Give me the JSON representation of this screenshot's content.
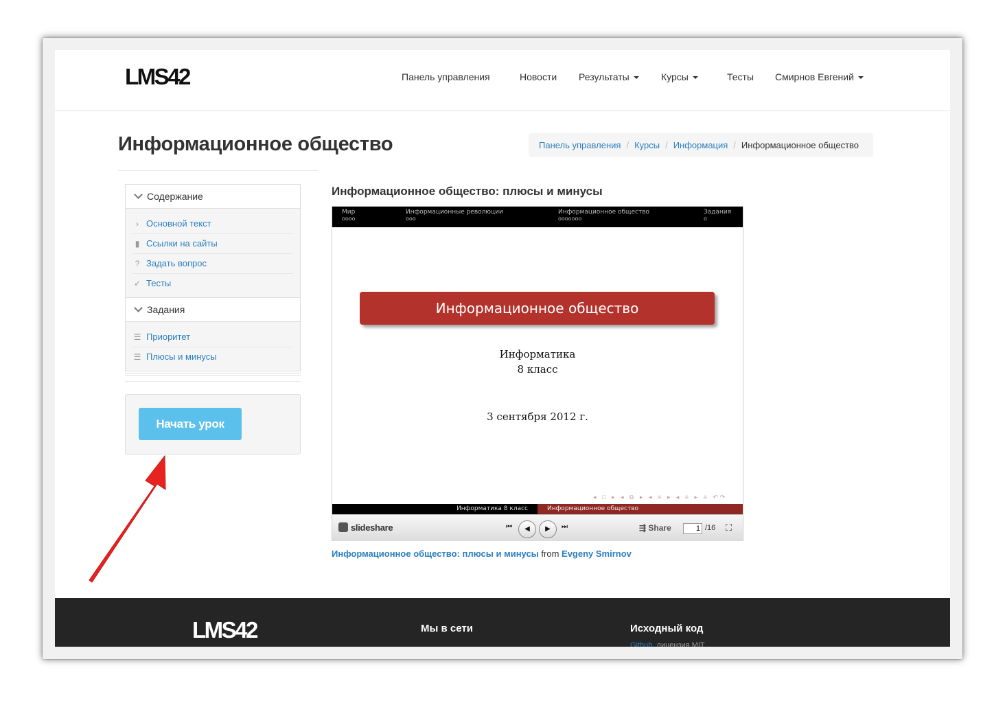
{
  "navbar": {
    "logo": "LMS42",
    "links": [
      "Панель управления",
      "Новости",
      "Результаты",
      "Курсы",
      "Тесты",
      "Смирнов Евгений"
    ]
  },
  "page": {
    "title": "Информационное общество",
    "breadcrumb": [
      "Панель управления",
      "Курсы",
      "Информация",
      "Информационное общество"
    ]
  },
  "sidebar": {
    "contents_header": "Содержание",
    "contents_items": [
      {
        "icon": "chevron-right-icon",
        "label": "Основной текст"
      },
      {
        "icon": "bookmark-icon",
        "label": "Ссылки на сайты"
      },
      {
        "icon": "question-icon",
        "label": "Задать вопрос"
      },
      {
        "icon": "check-icon",
        "label": "Тесты"
      }
    ],
    "tasks_header": "Задания",
    "tasks_items": [
      {
        "icon": "list-icon",
        "label": "Приоритет"
      },
      {
        "icon": "list-icon",
        "label": "Плюсы и минусы"
      }
    ],
    "start_button": "Начать урок"
  },
  "main": {
    "heading": "Информационное общество: плюсы и минусы",
    "slide": {
      "sections": [
        {
          "name": "Мир",
          "dots": "oooo"
        },
        {
          "name": "Информационные революции",
          "dots": "ooo"
        },
        {
          "name": "Информационное общество",
          "dots": "ooooooo"
        },
        {
          "name": "Задания",
          "dots": "o"
        }
      ],
      "title": "Информационное общество",
      "subject": "Информатика",
      "grade": "8 класс",
      "date": "3 сентября 2012 г.",
      "footer_left": "Информатика   8 класс",
      "footer_right": "Информационное общество"
    },
    "player": {
      "brand": "slideshare",
      "share": "Share",
      "current_page": "1",
      "total_pages": "/16"
    },
    "credit": {
      "link_title": "Информационное общество: плюсы и минусы",
      "from": "from",
      "author": "Evgeny Smirnov"
    }
  },
  "footer": {
    "logo": "LMS42",
    "col2_title": "Мы в сети",
    "col3_title": "Исходный код",
    "col3_link": "Github",
    "col3_text": ", лицензия MIT"
  },
  "colors": {
    "link": "#2a7fc0",
    "button": "#5bc0eb",
    "slide_accent": "#b3322c",
    "arrow": "#e8231f"
  }
}
